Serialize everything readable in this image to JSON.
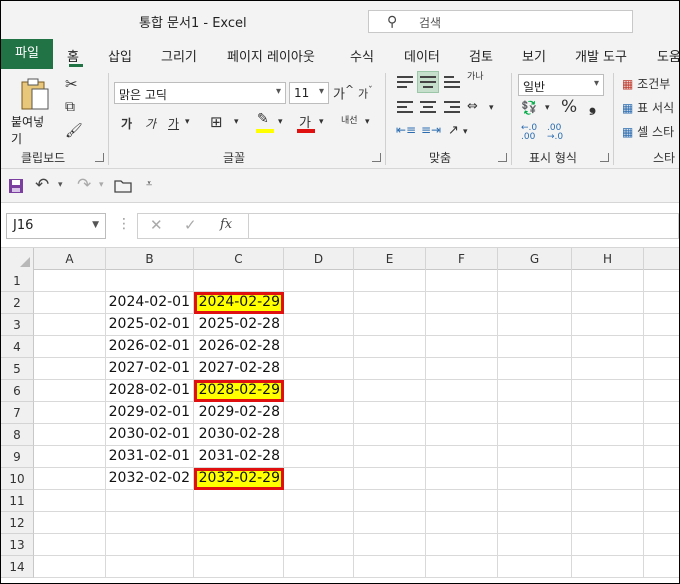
{
  "window": {
    "title": "통합 문서1  -  Excel",
    "search_placeholder": "검색"
  },
  "tabs": [
    "파일",
    "홈",
    "삽입",
    "그리기",
    "페이지 레이아웃",
    "수식",
    "데이터",
    "검토",
    "보기",
    "개발 도구",
    "도움"
  ],
  "ribbon": {
    "clipboard": {
      "paste_label": "붙여넣기",
      "group_label": "클립보드"
    },
    "font": {
      "font_name": "맑은 고딕",
      "font_size": "11",
      "grow": "가",
      "shrink": "가",
      "bold": "가",
      "italic": "가",
      "underline": "가",
      "font_color_glyph": "가",
      "phonetic": "내선",
      "group_label": "글꼴"
    },
    "alignment": {
      "group_label": "맞춤",
      "wrap_glyph": "가나"
    },
    "number": {
      "format": "일반",
      "group_label": "표시 형식"
    },
    "styles": {
      "conditional": "조건부",
      "as_table": "표 서식",
      "cell_styles": "셀 스타",
      "group_label": "스타"
    }
  },
  "formula_bar": {
    "name_box": "J16",
    "fx": "fx",
    "value": ""
  },
  "grid": {
    "columns": [
      "A",
      "B",
      "C",
      "D",
      "E",
      "F",
      "G",
      "H"
    ],
    "rows": [
      {
        "n": "1",
        "B": "",
        "C": "",
        "hl": false
      },
      {
        "n": "2",
        "B": "2024-02-01",
        "C": "2024-02-29",
        "hl": true
      },
      {
        "n": "3",
        "B": "2025-02-01",
        "C": "2025-02-28",
        "hl": false
      },
      {
        "n": "4",
        "B": "2026-02-01",
        "C": "2026-02-28",
        "hl": false
      },
      {
        "n": "5",
        "B": "2027-02-01",
        "C": "2027-02-28",
        "hl": false
      },
      {
        "n": "6",
        "B": "2028-02-01",
        "C": "2028-02-29",
        "hl": true
      },
      {
        "n": "7",
        "B": "2029-02-01",
        "C": "2029-02-28",
        "hl": false
      },
      {
        "n": "8",
        "B": "2030-02-01",
        "C": "2030-02-28",
        "hl": false
      },
      {
        "n": "9",
        "B": "2031-02-01",
        "C": "2031-02-28",
        "hl": false
      },
      {
        "n": "10",
        "B": "2032-02-02",
        "C": "2032-02-29",
        "hl": true
      },
      {
        "n": "11",
        "B": "",
        "C": "",
        "hl": false
      },
      {
        "n": "12",
        "B": "",
        "C": "",
        "hl": false
      },
      {
        "n": "13",
        "B": "",
        "C": "",
        "hl": false
      },
      {
        "n": "14",
        "B": "",
        "C": "",
        "hl": false
      }
    ]
  },
  "colors": {
    "accent": "#217346",
    "highlight_fill": "#ffff00",
    "highlight_border": "#e01010"
  }
}
